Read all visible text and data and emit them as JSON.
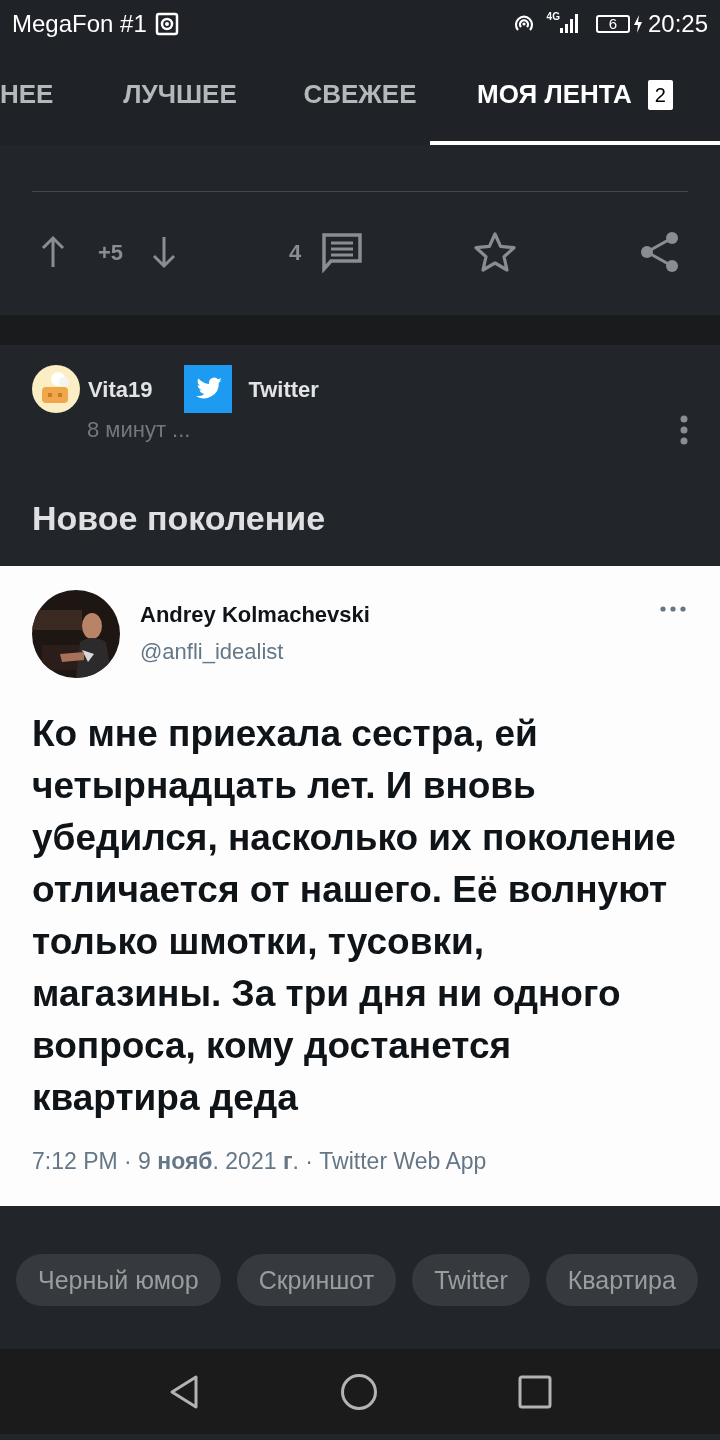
{
  "status_bar": {
    "carrier": "MegaFon #1",
    "network": "4G",
    "battery": "6",
    "time": "20:25"
  },
  "tabs": [
    {
      "label": "НЕЕ",
      "selected": false
    },
    {
      "label": "ЛУЧШЕЕ",
      "selected": false
    },
    {
      "label": "СВЕЖЕЕ",
      "selected": false
    },
    {
      "label": "МОЯ ЛЕНТА",
      "selected": true,
      "badge": "2"
    }
  ],
  "previous_post": {
    "rating": "+5",
    "comments": "4"
  },
  "post": {
    "author": "Vita19",
    "community": "Twitter",
    "time": "8 минут ...",
    "title": "Новое поколение",
    "tweet": {
      "name": "Andrey Kolmachevski",
      "handle": "@anfli_idealist",
      "text": "Ко мне приехала сестра, ей четырнадцать лет. И вновь убедился, насколько их поколение отличается от нашего. Её волнуют только шмотки, тусовки, магазины. За три дня ни одного вопроса, кому достанется квартира деда",
      "meta": "7:12 PM · 9 **нояб**. 2021 **г**. · Twitter Web App"
    },
    "tags": [
      "Черный юмор",
      "Скриншот",
      "Twitter",
      "Квартира"
    ]
  }
}
